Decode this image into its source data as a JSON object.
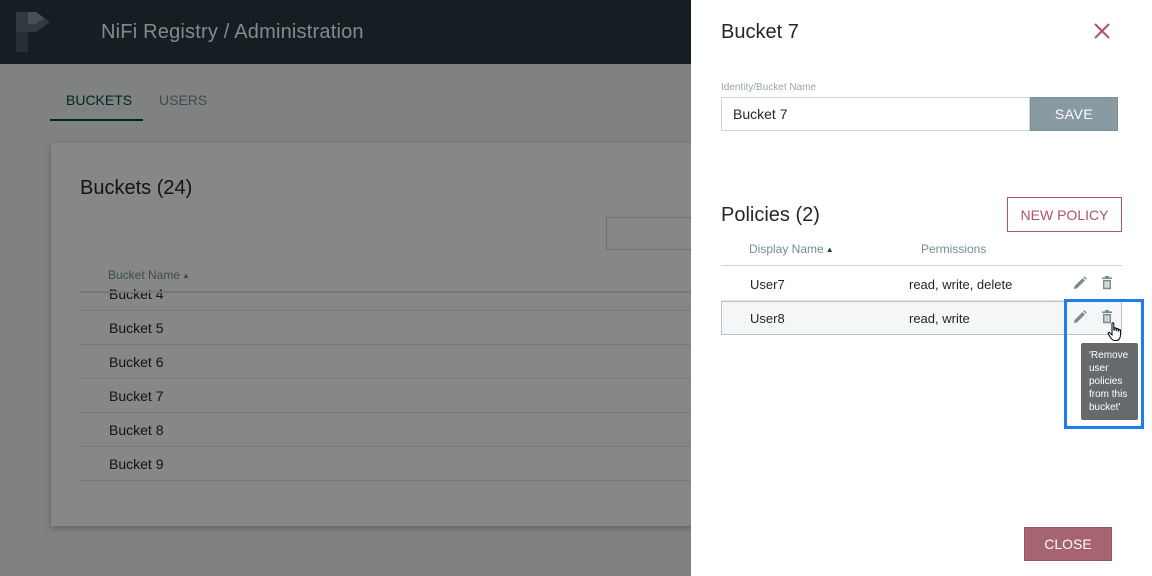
{
  "app": {
    "title": "NiFi Registry / Administration",
    "tabs": [
      {
        "label": "BUCKETS",
        "active": true
      },
      {
        "label": "USERS",
        "active": false
      }
    ],
    "buckets_card": {
      "title": "Buckets (24)",
      "column_header": "Bucket Name",
      "sort": "ascending",
      "rows": [
        "Bucket 4",
        "Bucket 5",
        "Bucket 6",
        "Bucket 7",
        "Bucket 8",
        "Bucket 9"
      ]
    }
  },
  "panel": {
    "title": "Bucket 7",
    "field_label": "Identity/Bucket Name",
    "field_value": "Bucket 7",
    "save_label": "SAVE",
    "policies_title": "Policies (2)",
    "new_policy_label": "NEW POLICY",
    "columns": {
      "display_name": "Display Name",
      "permissions": "Permissions"
    },
    "policies": [
      {
        "name": "User7",
        "permissions": "read, write, delete"
      },
      {
        "name": "User8",
        "permissions": "read, write",
        "selected": true
      }
    ],
    "tooltip": "'Remove user policies from this bucket'",
    "close_label": "CLOSE"
  },
  "colors": {
    "topbar": "#273a43",
    "accent": "#ad5566",
    "close_button": "#a66470",
    "highlight": "#1a7ff0"
  },
  "icons": [
    "nifi-registry-logo-icon",
    "close-icon",
    "edit-pencil-icon",
    "delete-trash-icon",
    "hand-pointer-cursor-icon",
    "sort-ascending-icon"
  ]
}
